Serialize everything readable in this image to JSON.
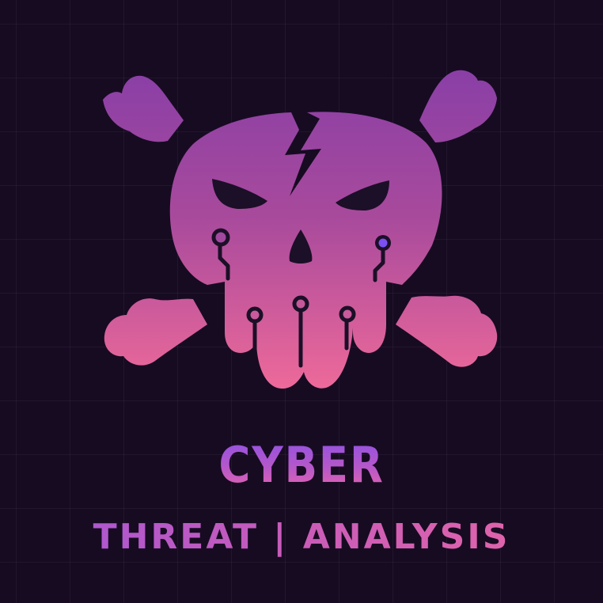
{
  "logo": {
    "title": "CYBER",
    "subtitle": "THREAT | ANALYSIS",
    "emblem_icon": "cracked-circuit-skull-icon",
    "crossbones_icon": "crossbones-icon"
  },
  "colors": {
    "background": "#170b22",
    "grid_line": "#2a1d36",
    "gradient_top": "#8a3fa6",
    "gradient_bottom": "#f06b9a",
    "eye_socket": "#1c0f28",
    "circuit_dot_accent": "#7b4ff2"
  }
}
